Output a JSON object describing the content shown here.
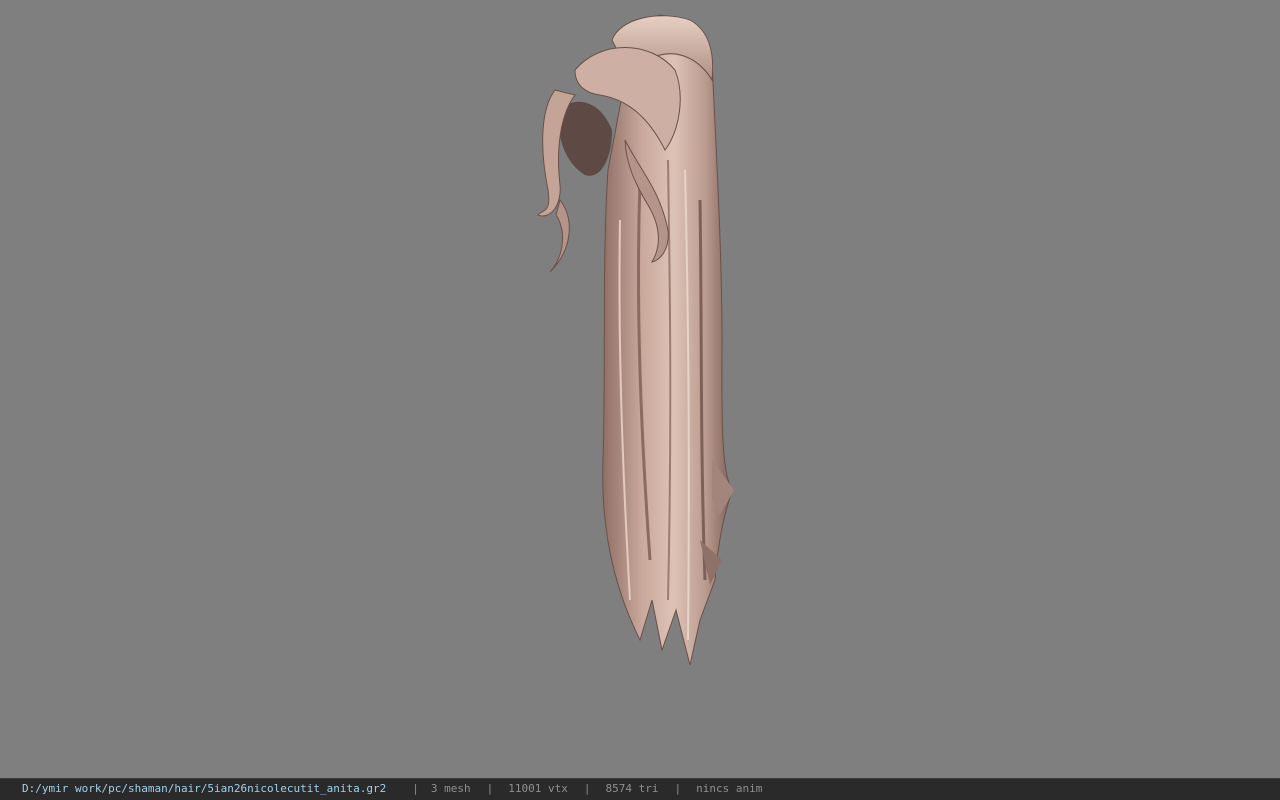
{
  "viewport": {
    "background_color": "#7f7f7f",
    "hair_color": "#c9a99c"
  },
  "statusbar": {
    "file_path": "D:/ymir work/pc/shaman/hair/5ian26nicolecutit_anita.gr2",
    "separator": "|",
    "mesh_count": "3 mesh",
    "vertex_count": "11001 vtx",
    "triangle_count": "8574 tri",
    "anim_status": "nincs anim"
  }
}
